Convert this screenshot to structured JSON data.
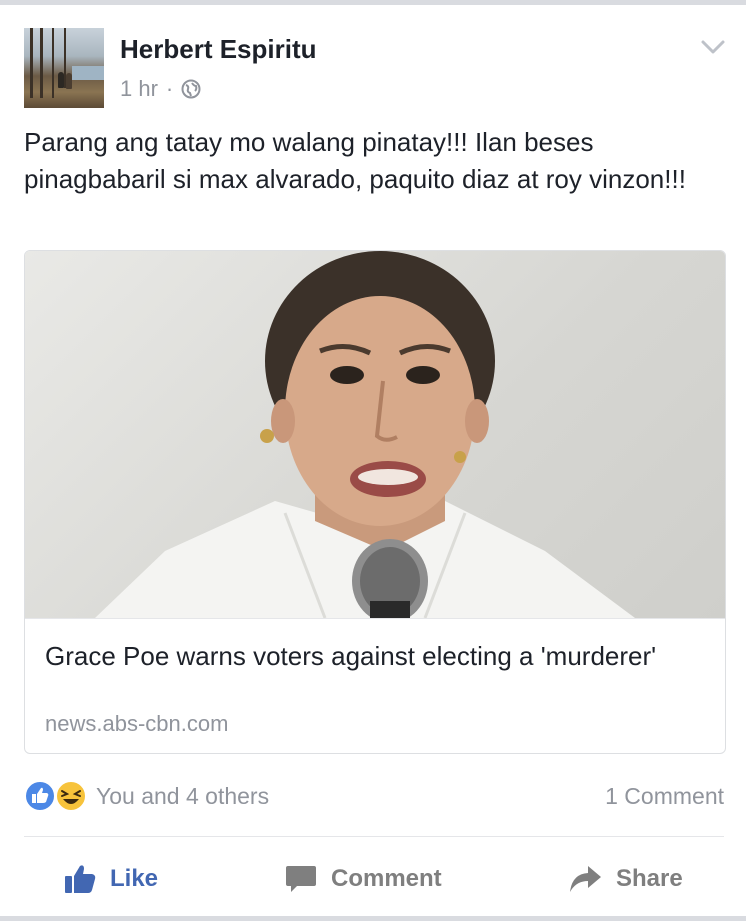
{
  "post": {
    "author": "Herbert Espiritu",
    "timestamp": "1 hr",
    "separator": "·",
    "privacy_icon": "globe-icon",
    "options_icon": "chevron-down-icon",
    "text": "Parang ang tatay mo walang pinatay!!! Ilan beses pinagbabaril si max alvarado, paquito diaz at roy vinzon!!!"
  },
  "link_card": {
    "title": "Grace Poe warns voters against electing a 'murderer'",
    "domain": "news.abs-cbn.com"
  },
  "reactions": {
    "icons": [
      "like-reaction-icon",
      "haha-reaction-icon"
    ],
    "summary": "You and 4 others",
    "comment_count": "1 Comment"
  },
  "actions": {
    "like_label": "Like",
    "comment_label": "Comment",
    "share_label": "Share"
  },
  "colors": {
    "like_blue": "#4267b2",
    "muted_text": "#90949c",
    "text": "#1d2129",
    "haha_yellow": "#f7c33b"
  }
}
